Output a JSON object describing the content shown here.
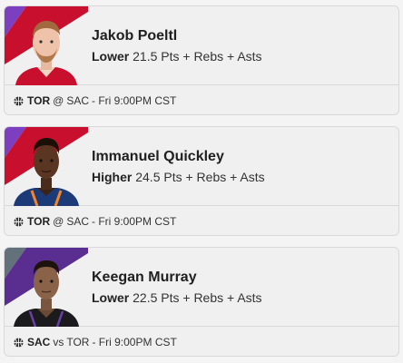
{
  "cards": [
    {
      "player_name": "Jakob Poeltl",
      "direction": "Lower",
      "line": "21.5",
      "stat": "Pts + Rebs + Asts",
      "team": "TOR",
      "connector": "@",
      "opponent": "SAC",
      "game_time": "- Fri 9:00PM CST",
      "corner_colors": [
        "#7b3fbf",
        "#c8102e"
      ],
      "icon": "basketball-icon"
    },
    {
      "player_name": "Immanuel Quickley",
      "direction": "Higher",
      "line": "24.5",
      "stat": "Pts + Rebs + Asts",
      "team": "TOR",
      "connector": "@",
      "opponent": "SAC",
      "game_time": "- Fri 9:00PM CST",
      "corner_colors": [
        "#7b3fbf",
        "#c8102e"
      ],
      "icon": "basketball-icon"
    },
    {
      "player_name": "Keegan Murray",
      "direction": "Lower",
      "line": "22.5",
      "stat": "Pts + Rebs + Asts",
      "team": "SAC",
      "connector": "vs",
      "opponent": "TOR",
      "game_time": "- Fri 9:00PM CST",
      "corner_colors": [
        "#5a2d91",
        "#63727a"
      ],
      "icon": "basketball-icon"
    }
  ]
}
